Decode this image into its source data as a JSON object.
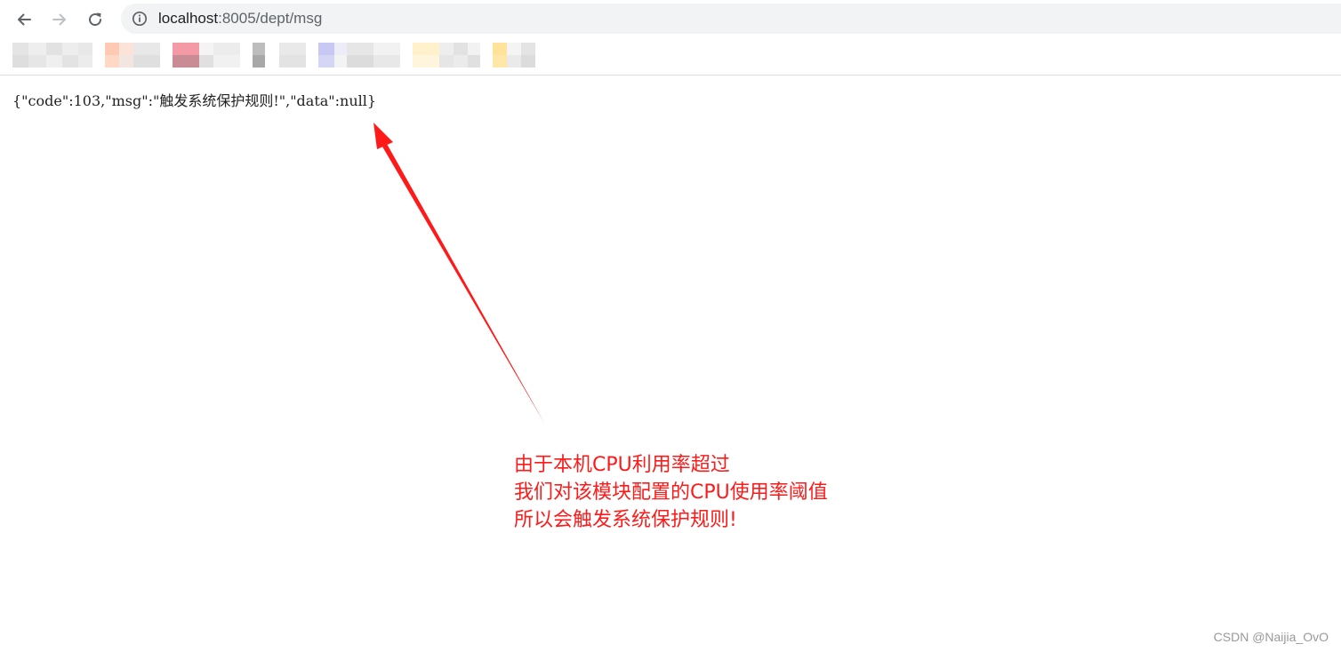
{
  "browser": {
    "address_bar": {
      "url_host": "localhost",
      "url_rest": ":8005/dept/msg"
    },
    "icons": {
      "back": "arrow-left-icon",
      "forward": "arrow-right-icon",
      "reload": "reload-icon",
      "site_info": "info-icon"
    }
  },
  "content": {
    "response_text": "{\"code\":103,\"msg\":\"触发系统保护规则!\",\"data\":null}"
  },
  "annotation": {
    "color": "#ff1a1a",
    "lines": [
      "由于本机CPU利用率超过",
      "我们对该模块配置的CPU使用率阈值",
      "所以会触发系统保护规则!"
    ]
  },
  "watermark": "CSDN @Naijia_OvO"
}
